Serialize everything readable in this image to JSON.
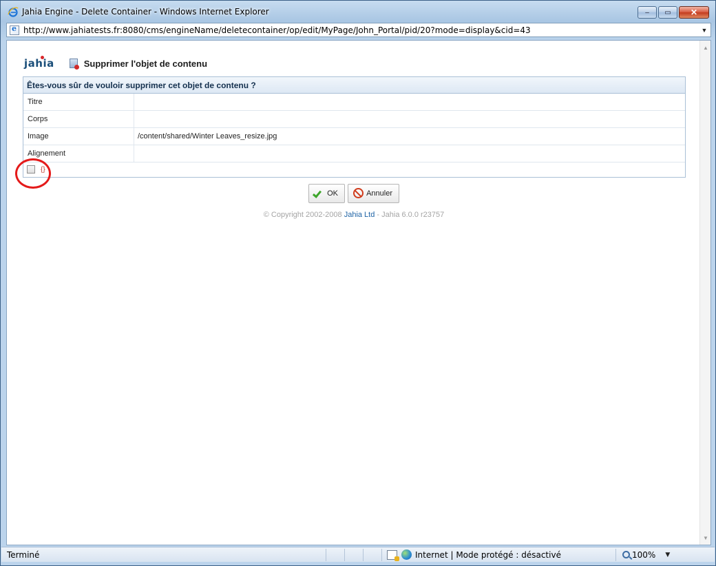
{
  "window": {
    "title": "Jahia Engine - Delete Container - Windows Internet Explorer",
    "minimize": "–",
    "restore": "▭",
    "close": "✕"
  },
  "address": {
    "url": "http://www.jahiatests.fr:8080/cms/engineName/deletecontainer/op/edit/MyPage/John_Portal/pid/20?mode=display&cid=43",
    "dropdown": "▼"
  },
  "header": {
    "logo": "jahia",
    "engine_title": "Supprimer l'objet de contenu"
  },
  "form": {
    "question": "Êtes-vous sûr de vouloir supprimer cet objet de contenu ?",
    "rows": [
      {
        "label": "Titre",
        "value": ""
      },
      {
        "label": "Corps",
        "value": ""
      },
      {
        "label": "Image",
        "value": "/content/shared/Winter Leaves_resize.jpg"
      },
      {
        "label": "Alignement",
        "value": ""
      }
    ],
    "confirm_label": "{}"
  },
  "buttons": {
    "ok": "OK",
    "cancel": "Annuler"
  },
  "footer": {
    "copyright_prefix": "© Copyright 2002-2008 ",
    "company_link": "Jahia Ltd",
    "copyright_suffix": " - Jahia 6.0.0 r23757"
  },
  "status": {
    "text": "Terminé",
    "zone": "Internet | Mode protégé : désactivé",
    "zoom": "100%",
    "zoom_arrow": "▼"
  },
  "scroll": {
    "up": "▲",
    "down": "▼"
  },
  "colors": {
    "highlight": "#e41a1a",
    "accent": "#1e63a5"
  }
}
